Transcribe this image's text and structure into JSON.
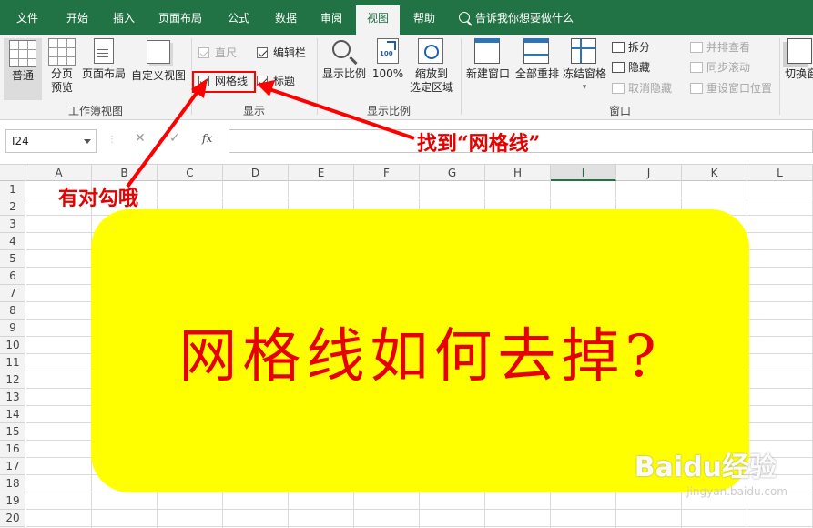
{
  "menubar": {
    "tabs": [
      "文件",
      "开始",
      "插入",
      "页面布局",
      "公式",
      "数据",
      "审阅",
      "视图",
      "帮助"
    ],
    "active_tab": "视图",
    "tell_me": "告诉我你想要做什么",
    "color": "#217346"
  },
  "ribbon": {
    "workbook_views": {
      "normal": "普通",
      "page_break_1": "分页",
      "page_break_2": "预览",
      "page_layout": "页面布局",
      "custom_views": "自定义视图",
      "group_label": "工作簿视图"
    },
    "show": {
      "ruler": "直尺",
      "formula_bar": "编辑栏",
      "gridlines": "网格线",
      "headings": "标题",
      "group_label": "显示",
      "ruler_checked": true,
      "formula_bar_checked": true,
      "gridlines_checked": true,
      "headings_checked": true
    },
    "zoom": {
      "zoom": "显示比例",
      "zoom_100": "100%",
      "zoom_100_icon_text": "100",
      "zoom_to_selection_1": "缩放到",
      "zoom_to_selection_2": "选定区域",
      "group_label": "显示比例"
    },
    "window": {
      "new_window": "新建窗口",
      "arrange_all": "全部重排",
      "freeze_panes": "冻结窗格",
      "split": "拆分",
      "hide": "隐藏",
      "unhide": "取消隐藏",
      "view_side_by_side": "并排查看",
      "sync_scroll": "同步滚动",
      "reset_position": "重设窗口位置",
      "switch_windows": "切换窗",
      "group_label": "窗口"
    }
  },
  "formula_bar": {
    "name_box": "I24",
    "cancel": "✕",
    "enter": "✓",
    "fx": "fx",
    "value": ""
  },
  "grid": {
    "columns": [
      "A",
      "B",
      "C",
      "D",
      "E",
      "F",
      "G",
      "H",
      "I",
      "J",
      "K",
      "L"
    ],
    "selected_column": "I",
    "rows": [
      "1",
      "2",
      "3",
      "4",
      "5",
      "6",
      "7",
      "8",
      "9",
      "10",
      "11",
      "12",
      "13",
      "14",
      "15",
      "16",
      "17",
      "18",
      "19",
      "20"
    ]
  },
  "overlay": {
    "title": "网格线如何去掉?",
    "annotation_find": "找到“网格线”",
    "annotation_checked": "有对勾哦",
    "highlight_color": "#ff0000",
    "card_color": "#ffff00",
    "watermark": "Baidu经验",
    "watermark_sub": "jingyan.baidu.com"
  }
}
